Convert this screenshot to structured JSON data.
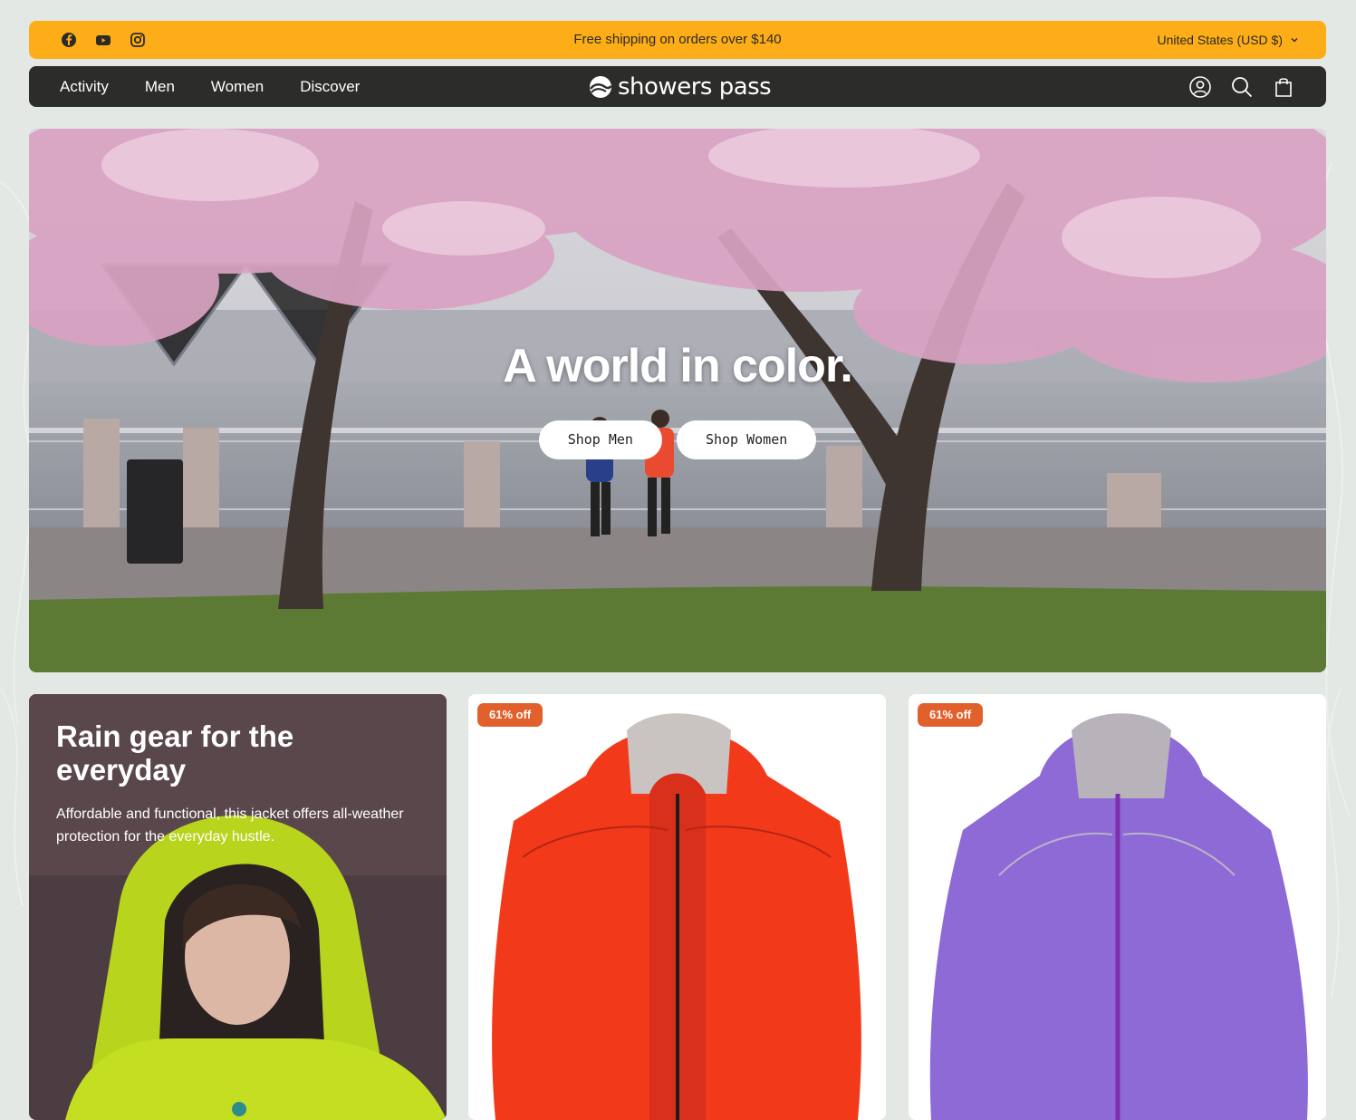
{
  "announcement": {
    "social_icons": [
      "facebook-icon",
      "youtube-icon",
      "instagram-icon"
    ],
    "text": "Free shipping on orders over $140",
    "currency": "United States (USD $)",
    "bg_color": "#fdad17"
  },
  "nav": {
    "links": [
      "Activity",
      "Men",
      "Women",
      "Discover"
    ],
    "logo": "showers pass",
    "icons": [
      "account-icon",
      "search-icon",
      "cart-icon"
    ],
    "bg_color": "#2c2c2a"
  },
  "hero": {
    "title": "A world in color.",
    "buttons": [
      "Shop Men",
      "Shop Women"
    ]
  },
  "cards": [
    {
      "type": "promo",
      "title": "Rain gear for the everyday",
      "text": "Affordable and functional, this jacket offers all-weather protection for the everyday hustle."
    },
    {
      "type": "product",
      "badge": "61% off",
      "jacket_color": "#f23a1b"
    },
    {
      "type": "product",
      "badge": "61% off",
      "jacket_color": "#8e6ad6"
    }
  ]
}
